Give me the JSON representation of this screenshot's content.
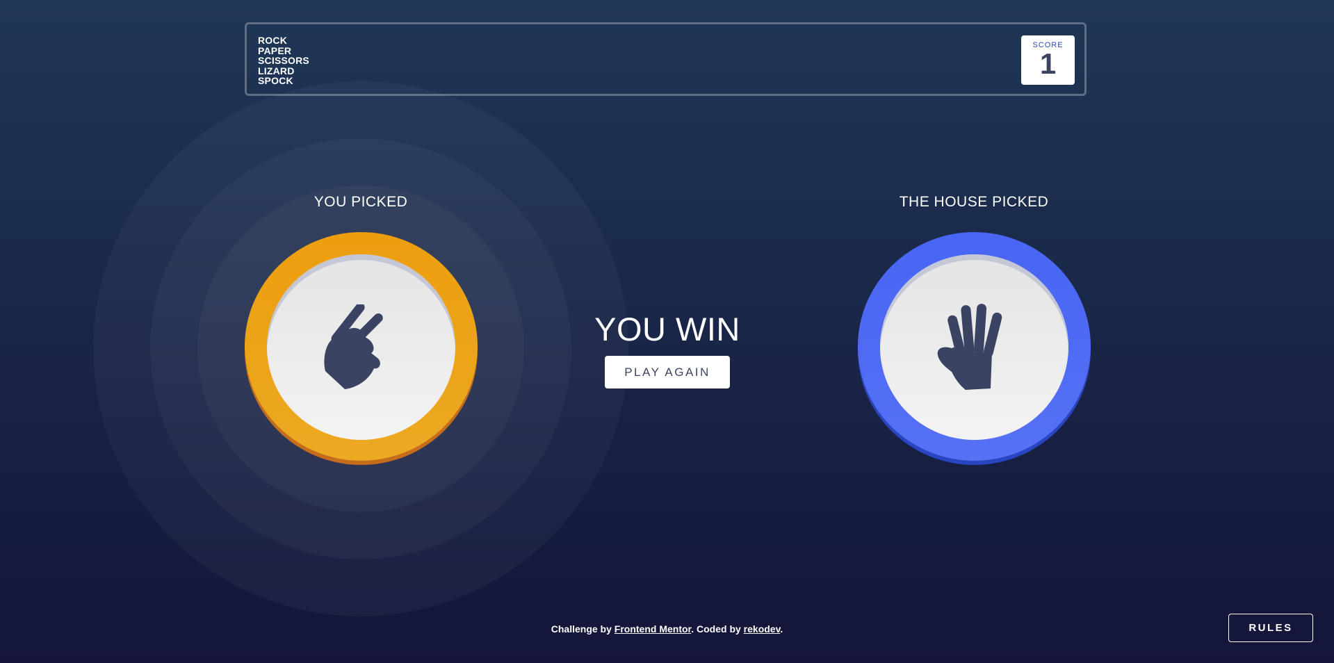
{
  "header": {
    "title_lines": [
      "ROCK",
      "PAPER",
      "SCISSORS",
      "LIZARD",
      "SPOCK"
    ],
    "score_label": "SCORE",
    "score_value": "1"
  },
  "game": {
    "user_label": "YOU PICKED",
    "house_label": "THE HOUSE PICKED",
    "user_pick": {
      "name": "scissors",
      "icon": "scissors-hand-icon",
      "color": "#ec9e0e"
    },
    "house_pick": {
      "name": "paper",
      "icon": "paper-hand-icon",
      "color": "#4865f4"
    },
    "result_text": "YOU WIN",
    "play_again_label": "PLAY AGAIN"
  },
  "footer": {
    "prefix": "Challenge by ",
    "challenge_link": "Frontend Mentor",
    "middle": ". Coded by ",
    "author_link": "rekodev",
    "suffix": "."
  },
  "rules_label": "RULES",
  "colors": {
    "background_top": "#1f3756",
    "background_bottom": "#141539",
    "header_border": "#606e85",
    "score_text": "#3b4363",
    "score_label": "#2a46c0",
    "icon": "#3b4363"
  }
}
